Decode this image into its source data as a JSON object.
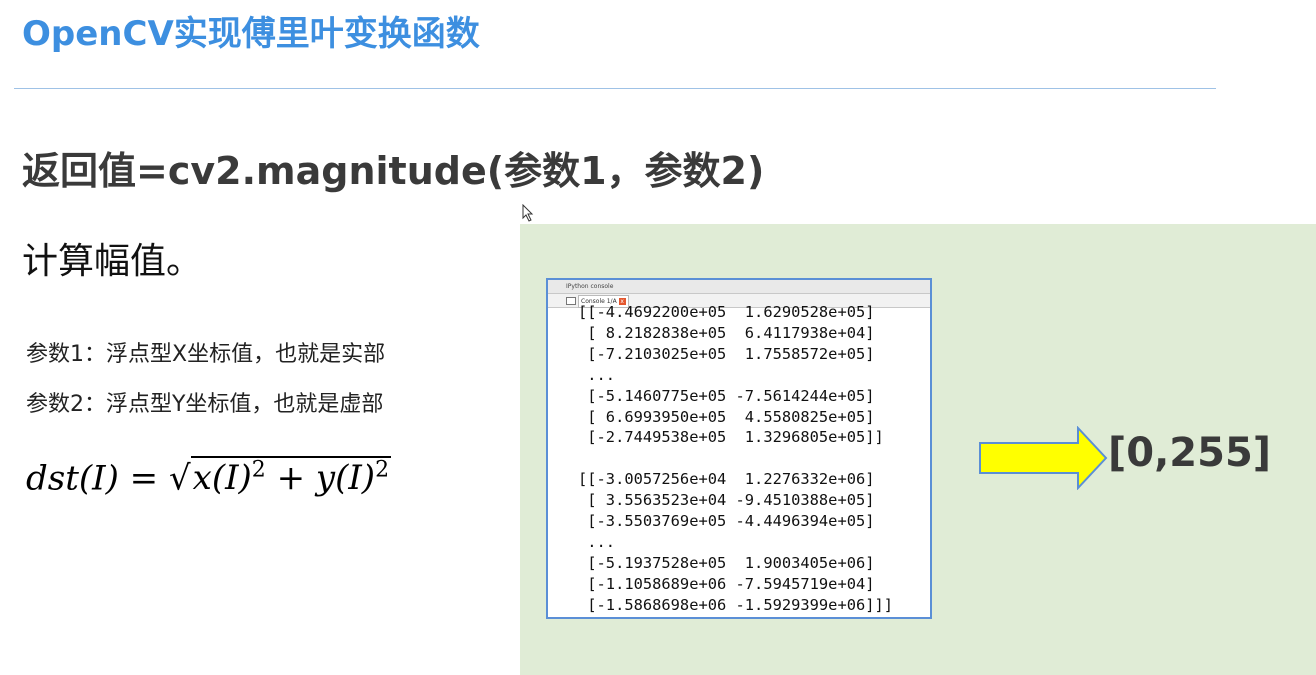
{
  "slide": {
    "title": "OpenCV实现傅里叶变换函数",
    "syntax": "返回值=cv2.magnitude(参数1，参数2)",
    "description": "计算幅值。",
    "params": [
      "参数1：浮点型X坐标值，也就是实部",
      "参数2：浮点型Y坐标值，也就是虚部"
    ],
    "formula": {
      "lhs": "dst(I)",
      "equals": "=",
      "term1": "x(I)",
      "plus": "+",
      "term2": "y(I)",
      "exponent": "2"
    },
    "range_label": "[0,255]"
  },
  "console": {
    "window_title": "IPython console",
    "tab_label": "Console 1/A",
    "close_glyph": "x",
    "output": "[[-4.4692200e+05  1.6290528e+05]\n [ 8.2182838e+05  6.4117938e+04]\n [-7.2103025e+05  1.7558572e+05]\n ...\n [-5.1460775e+05 -7.5614244e+05]\n [ 6.6993950e+05  4.5580825e+05]\n [-2.7449538e+05  1.3296805e+05]]\n\n[[-3.0057256e+04  1.2276332e+06]\n [ 3.5563523e+04 -9.4510388e+05]\n [-3.5503769e+05 -4.4496394e+05]\n ...\n [-5.1937528e+05  1.9003405e+06]\n [-1.1058689e+06 -7.5945719e+04]\n [-1.5868698e+06 -1.5929399e+06]]]"
  },
  "colors": {
    "title": "#3d8fe0",
    "panel": "#e0ecd6",
    "arrow_fill": "#ffff00",
    "arrow_stroke": "#5b8fd6"
  }
}
